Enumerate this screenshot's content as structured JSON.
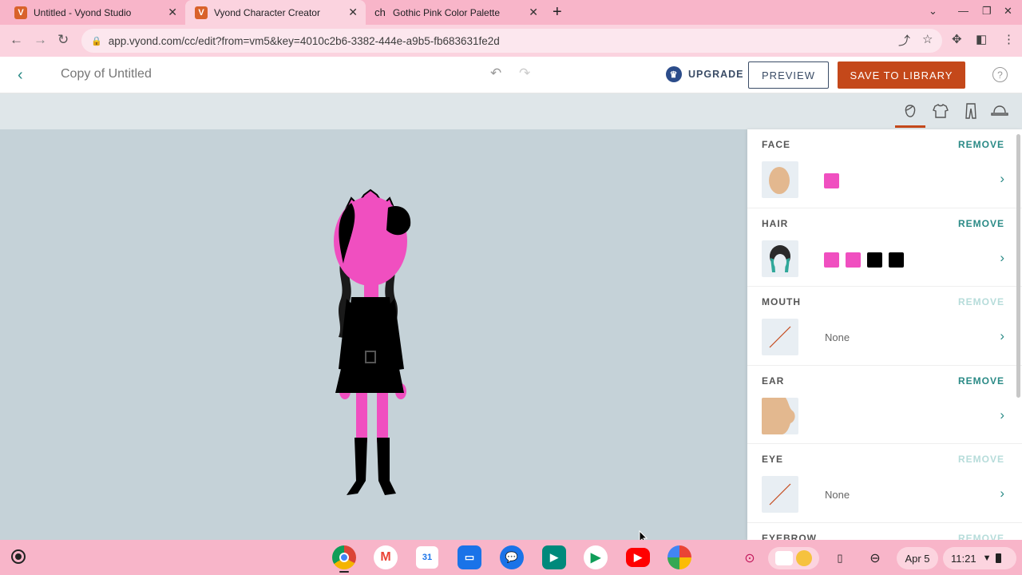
{
  "browser": {
    "tabs": [
      {
        "title": "Untitled - Vyond Studio",
        "favicon": "V",
        "active": false
      },
      {
        "title": "Vyond Character Creator",
        "favicon": "V",
        "active": true
      },
      {
        "title": "Gothic Pink Color Palette",
        "favicon": "ch",
        "active": false
      }
    ],
    "url": "app.vyond.com/cc/edit?from=vm5&key=4010c2b6-3382-444e-a9b5-fb683631fe2d"
  },
  "app": {
    "doc_title": "Copy of Untitled",
    "upgrade_label": "UPGRADE",
    "preview_label": "PREVIEW",
    "save_label": "SAVE TO LIBRARY",
    "help_label": "?",
    "categories": [
      "head-icon",
      "shirt-icon",
      "pants-icon",
      "hat-icon"
    ],
    "accent": "#c4481a",
    "teal": "#2a8a86"
  },
  "panel": {
    "sections": [
      {
        "label": "FACE",
        "remove": "REMOVE",
        "remove_enabled": true,
        "value": "",
        "swatches": [
          "#f04fc0"
        ]
      },
      {
        "label": "HAIR",
        "remove": "REMOVE",
        "remove_enabled": true,
        "value": "",
        "swatches": [
          "#f04fc0",
          "#f04fc0",
          "#000000",
          "#000000"
        ]
      },
      {
        "label": "MOUTH",
        "remove": "REMOVE",
        "remove_enabled": false,
        "value": "None",
        "swatches": []
      },
      {
        "label": "EAR",
        "remove": "REMOVE",
        "remove_enabled": true,
        "value": "",
        "swatches": []
      },
      {
        "label": "EYE",
        "remove": "REMOVE",
        "remove_enabled": false,
        "value": "None",
        "swatches": []
      },
      {
        "label": "EYEBROW",
        "remove": "REMOVE",
        "remove_enabled": false,
        "value": "",
        "swatches": []
      }
    ]
  },
  "shelf": {
    "apps": [
      "chrome-icon",
      "gmail-icon",
      "calendar-icon",
      "files-icon",
      "messages-icon",
      "meet-icon",
      "play-store-icon",
      "youtube-icon",
      "photos-icon"
    ],
    "calendar_day": "31",
    "date": "Apr 5",
    "time": "11:21"
  }
}
